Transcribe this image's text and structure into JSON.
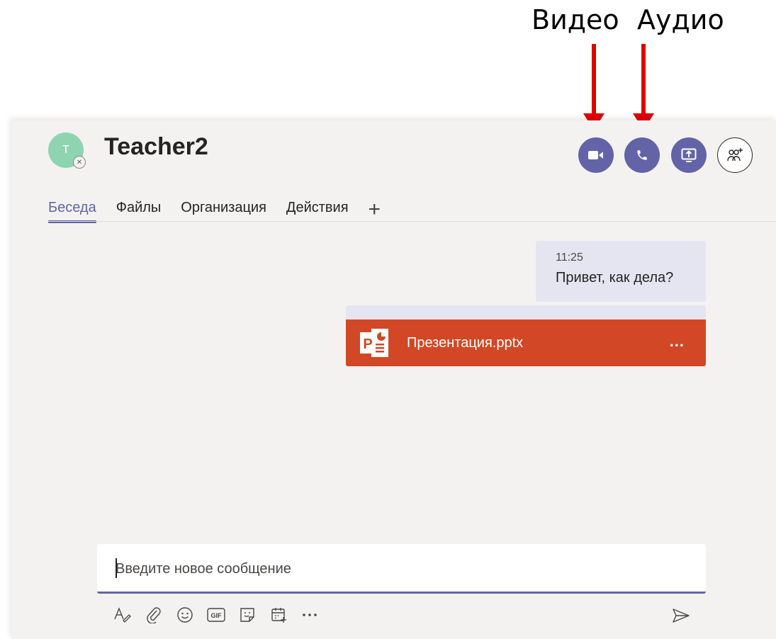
{
  "annotations": {
    "video_label": "Видео",
    "audio_label": "Аудио"
  },
  "chat": {
    "avatar_initial": "T",
    "contact_name": "Teacher2",
    "presence_icon": "offline-x-icon"
  },
  "header_buttons": [
    {
      "name": "video-call-button",
      "icon": "video-camera-icon"
    },
    {
      "name": "audio-call-button",
      "icon": "phone-icon"
    },
    {
      "name": "share-screen-button",
      "icon": "share-screen-icon"
    },
    {
      "name": "add-people-button",
      "icon": "add-people-icon"
    }
  ],
  "tabs": [
    {
      "label": "Беседа",
      "active": true
    },
    {
      "label": "Файлы",
      "active": false
    },
    {
      "label": "Организация",
      "active": false
    },
    {
      "label": "Действия",
      "active": false
    }
  ],
  "tab_add_label": "+",
  "message": {
    "time": "11:25",
    "text": "Привет, как дела?"
  },
  "attachment": {
    "file_name": "Презентация.pptx",
    "more_label": "...",
    "card_color": "#d24726"
  },
  "composer": {
    "placeholder": "Введите новое сообщение"
  },
  "toolbar_icons": [
    "format-icon",
    "attach-icon",
    "emoji-icon",
    "gif-icon",
    "sticker-icon",
    "schedule-meeting-icon",
    "more-icon",
    "send-icon"
  ],
  "colors": {
    "accent": "#6264a7",
    "annotation_arrow": "#e00000",
    "background": "#f3f2f1",
    "message_bubble": "#e5e5f1"
  }
}
